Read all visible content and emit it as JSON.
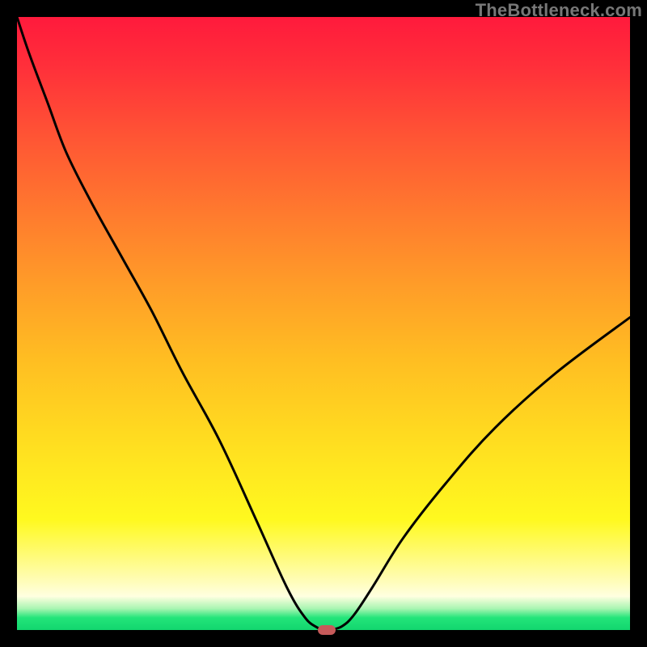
{
  "watermark": "TheBottleneck.com",
  "chart_data": {
    "type": "line",
    "title": "",
    "xlabel": "",
    "ylabel": "",
    "x": [
      0.0,
      0.02,
      0.05,
      0.08,
      0.12,
      0.17,
      0.22,
      0.27,
      0.33,
      0.39,
      0.44,
      0.47,
      0.49,
      0.5,
      0.51,
      0.53,
      0.55,
      0.58,
      0.63,
      0.7,
      0.78,
      0.88,
      1.0
    ],
    "values": [
      100,
      94,
      86,
      78,
      70,
      61,
      52,
      42,
      31,
      18,
      7,
      2,
      0.4,
      0,
      0,
      0.6,
      2.5,
      7,
      15,
      24,
      33,
      42,
      51
    ],
    "xlim": [
      0,
      1
    ],
    "ylim": [
      0,
      100
    ],
    "marker": {
      "x": 0.505,
      "y": 0
    },
    "colors": {
      "line": "#000000",
      "marker": "#c65a5a"
    }
  }
}
